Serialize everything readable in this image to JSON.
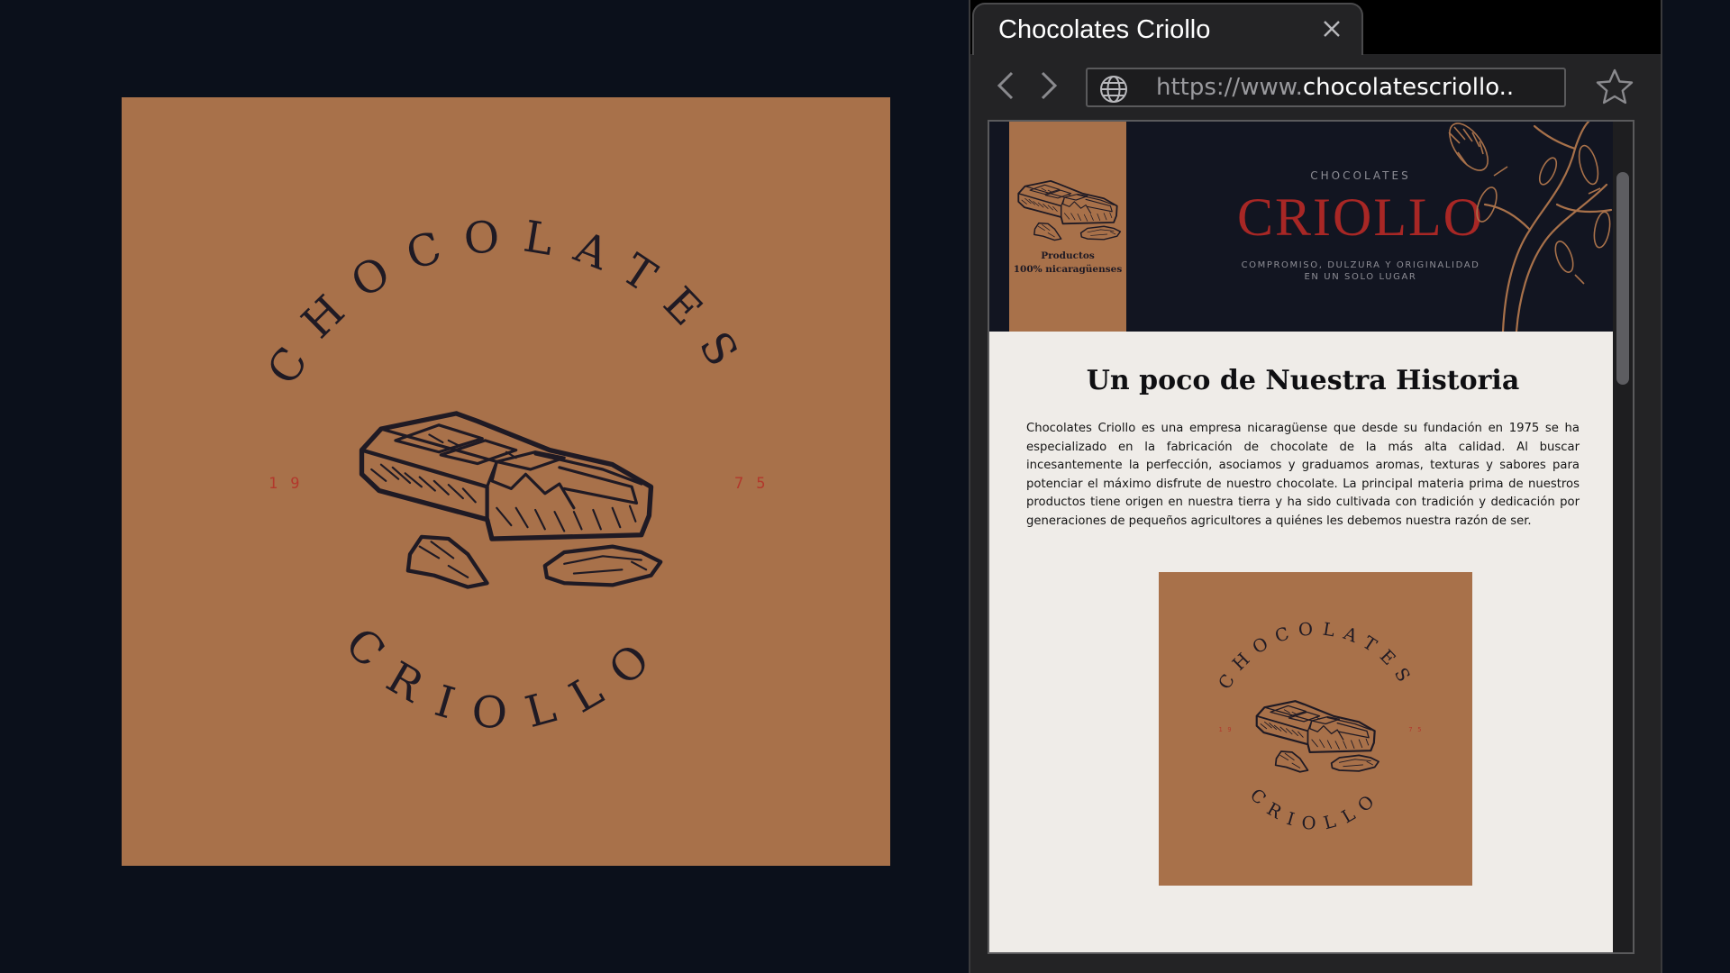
{
  "logo": {
    "top_text": "CHOCOLATES",
    "bottom_text": "CRIOLLO",
    "year_left": "19",
    "year_right": "75"
  },
  "browser": {
    "tab_title": "Chocolates Criollo",
    "url_prefix": "https://www.",
    "url_domain": "chocolatescriollo.."
  },
  "page": {
    "hero": {
      "side_line1": "Productos",
      "side_line2": "100% nicaragüenses",
      "kicker": "CHOCOLATES",
      "brand": "CRIOLLO",
      "tagline_line1": "COMPROMISO, DULZURA Y ORIGINALIDAD",
      "tagline_line2": "EN UN SOLO LUGAR"
    },
    "history_title": "Un poco de Nuestra Historia",
    "history_body": "Chocolates Criollo es una empresa nicaragüense que desde su fundación en 1975 se ha especializado en la fabricación de chocolate de la más alta calidad. Al buscar incesantemente la perfección, asociamos y graduamos aromas, texturas y sabores para potenciar el máximo disfrute de nuestro chocolate. La principal materia prima de nuestros productos tiene origen en nuestra tierra y ha sido cultivada con tradición y dedicación por generaciones de pequeños agricultores a quiénes les debemos nuestra razón de ser."
  },
  "colors": {
    "background": "#0b101b",
    "logo_tan": "#a8714a",
    "ink": "#1f1a24",
    "brand_red": "#a82725",
    "hero_navy": "#121521",
    "page_bg": "#efece8"
  },
  "icons": [
    "chocolate-bar-icon",
    "close-icon",
    "back-arrow-icon",
    "forward-arrow-icon",
    "globe-icon",
    "star-icon",
    "cacao-tree-icon"
  ]
}
